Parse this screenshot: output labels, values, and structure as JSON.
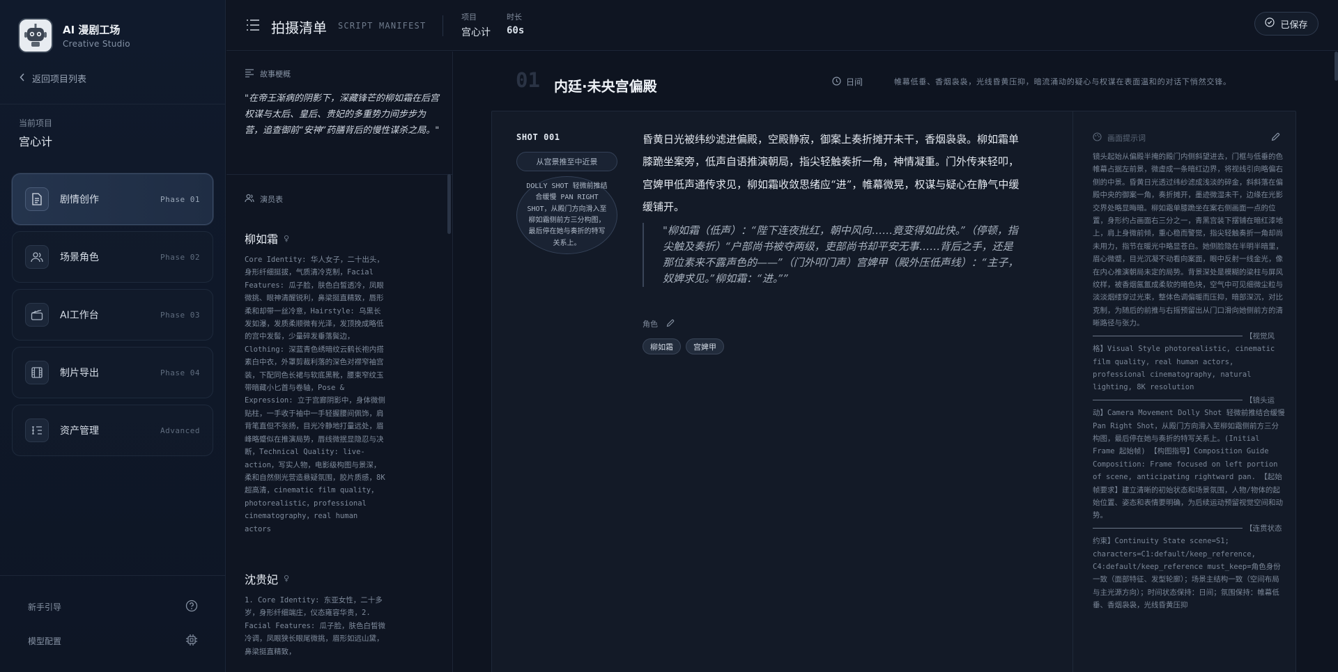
{
  "brand": {
    "title": "AI 漫剧工场",
    "subtitle": "Creative Studio"
  },
  "sidebar": {
    "back_label": "返回项目列表",
    "current_project_label": "当前项目",
    "current_project_name": "宫心计",
    "nav": [
      {
        "label": "剧情创作",
        "phase": "Phase 01",
        "icon": "document-icon",
        "active": true
      },
      {
        "label": "场景角色",
        "phase": "Phase 02",
        "icon": "users-icon",
        "active": false
      },
      {
        "label": "AI工作台",
        "phase": "Phase 03",
        "icon": "clapperboard-icon",
        "active": false
      },
      {
        "label": "制片导出",
        "phase": "Phase 04",
        "icon": "film-icon",
        "active": false
      },
      {
        "label": "资产管理",
        "phase": "Advanced",
        "icon": "list-icon",
        "active": false
      }
    ],
    "footer": {
      "guide_label": "新手引导",
      "model_label": "模型配置"
    }
  },
  "header": {
    "title": "拍摄清单",
    "subtitle": "SCRIPT MANIFEST",
    "project_label": "项目",
    "project_value": "宫心计",
    "duration_label": "时长",
    "duration_value": "60s",
    "saved_label": "已保存"
  },
  "story": {
    "synopsis_label": "故事梗概",
    "synopsis": "\"在帝王渐病的阴影下，深藏锋芒的柳如霜在后宫权谋与太后、皇后、贵妃的多重势力间步步为营，追查御前“安神”药膳背后的慢性谋杀之局。\"",
    "cast_label": "演员表",
    "cast": [
      {
        "name": "柳如霜",
        "desc": "Core Identity: 华人女子，二十出头，身形纤细挺拔，气质清冷克制，Facial Features: 瓜子脸，肤色白皙透冷，凤眼微挑、眼神清醒锐利，鼻梁挺直精致，唇形柔和却带一丝冷意，Hairstyle: 乌黑长发如瀑，发质柔顺微有光泽，发顶挽成略低的宫中发髻，少量碎发垂落鬓边，Clothing: 深蓝青色绣暗纹云鹤长袍内搭素白中衣，外罩剪裁利落的深色对襟窄袖宫装，下配同色长裙与软底黑靴，腰束窄纹玉带暗藏小匕首与卷轴，Pose & Expression: 立于宫廊阴影中，身体微侧贴柱，一手收于袖中一手轻握腰间佩饰，肩背笔直但不张扬，目光冷静地打量远处，眉峰略蹙似在推演局势，唇线微抿显隐忍与决断，Technical Quality: live-action，写实人物，电影级构图与景深，柔和自然侧光营造悬疑氛围，胶片质感，8K 超高清，cinematic film quality，photorealistic，professional cinematography，real human actors"
      },
      {
        "name": "沈贵妃",
        "desc": "1. Core Identity: 东亚女性，二十多岁，身形纤细端庄，仪态雍容华贵，2. Facial Features: 瓜子脸，肤色白皙微冷调，凤眼狭长眼尾微挑，眉形如远山黛，鼻梁挺直精致，"
      }
    ]
  },
  "scene": {
    "number": "01",
    "title": "内廷·未央宫偏殿",
    "time_label": "日间",
    "mood": "帷幕低垂、香烟袅袅，光线昏黄压抑，暗流涌动的疑心与权谋在表面温和的对话下悄然交锋。"
  },
  "shot": {
    "id": "SHOT 001",
    "camera_move": "从宫景推至中近景",
    "camera_desc": "DOLLY SHOT 轻微前推结合缓慢 PAN RIGHT SHOT，从殿门方向滑入至柳如霜侧前方三分构图，最后停在她与奏折的特写关系上。",
    "narration": "昏黄日光被纬纱滤进偏殿，空殿静寂，御案上奏折摊开未干，香烟袅袅。柳如霜单膝跪坐案旁，低声自语推演朝局，指尖轻触奏折一角，神情凝重。门外传来轻叩，宫婢甲低声通传求见，柳如霜收敛思绪应“进”，帷幕微晃，权谋与疑心在静气中缓缓铺开。",
    "dialogue": "\"柳如霜（低声）：“陛下连夜批红，朝中风向……竟变得如此快。”（停顿，指尖触及奏折）“户部尚书被夺两级，吏部尚书却平安无事……背后之手，还是那位素来不露声色的——”（门外叩门声）宫婢甲（殿外压低声线）：“主子，奴婢求见。”柳如霜：“进。””",
    "roles_label": "角色",
    "roles": [
      "柳如霜",
      "宫婢甲"
    ],
    "prompt_label": "画面提示词",
    "prompt_intro": "镜头起始从偏殿半掩的殿门内侧斜望进去，门框与低垂的色帷幕占据左前景，微虚成一条暗红边界，将视线引向略偏右侧的中景。昏黄日光透过纬纱滤成浅淡的碎金，斜斜落在偏殿中央的御案一角，奏折摊开，墨迹微湿未干，边缘在光影交界处略显晦暗。柳如霜单膝跪坐在案右侧画面一点的位置，身形约占画面右三分之一，青黑宫装下摆铺在暗红漆地上，肩上身微前倾，重心稳而警觉，指尖轻触奏折一角却尚未用力，指节在暖光中略显苍白。她侧脸隐在半明半暗里，眉心微蹙，目光沉凝不动看向案面，眼中反射一线金光，像在内心推演朝局未定的局势。背景深处是模糊的梁柱与屏风纹样，被香烟氤氲成柔软的暗色块，空气中可见细微尘粒与淡淡烟缕穿过光束，整体色调偏暖而压抑，暗部深沉，对比克制，为随后的前推与右摇预留出从门口滑向她侧前方的清晰路径与张力。",
    "prompt_sections": [
      "【视觉风格】Visual Style photorealistic, cinematic film quality, real human actors, professional cinematography, natural lighting, 8K resolution",
      "【镜头运动】Camera Movement Dolly Shot 轻微前推结合缓慢 Pan Right Shot，从殿门方向滑入至柳如霜侧前方三分构图，最后停在她与奏折的特写关系上。(Initial Frame 起始帧) 【构图指导】Composition Guide Composition: Frame focused on left portion of scene, anticipating rightward pan. 【起始帧要求】建立清晰的初始状态和场景氛围，人物/物体的起始位置、姿态和表情要明确，为后续运动预留视觉空间和动势。",
      "【连贯状态约束】Continuity State scene=S1; characters=C1:default/keep_reference, C4:default/keep_reference must_keep=角色身份一致（面部特征、发型轮廓）；场景主结构一致（空间布局与主光源方向）；时间状态保持：日间；氛围保持：帷幕低垂、香烟袅袅，光线昏黄压抑"
    ]
  }
}
